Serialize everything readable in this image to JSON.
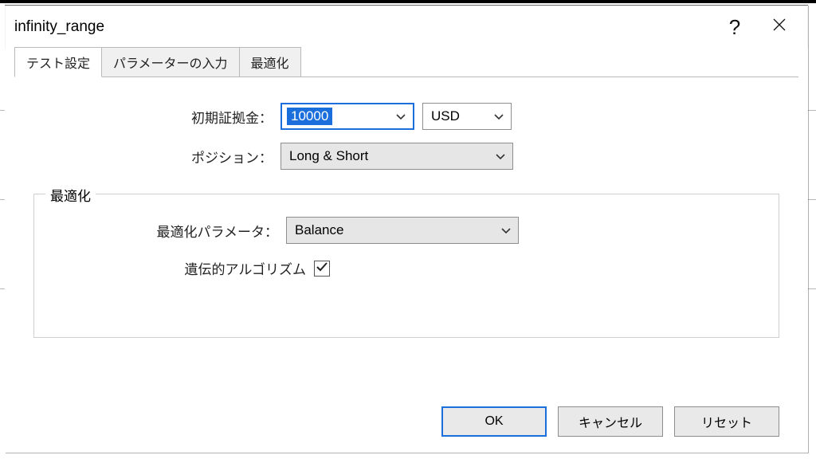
{
  "window": {
    "title": "infinity_range"
  },
  "tabs": [
    {
      "label": "テスト設定",
      "active": true
    },
    {
      "label": "パラメーターの入力",
      "active": false
    },
    {
      "label": "最適化",
      "active": false
    }
  ],
  "form": {
    "deposit_label": "初期証拠金：",
    "deposit_value": "10000",
    "currency_value": "USD",
    "position_label": "ポジション：",
    "position_value": "Long & Short"
  },
  "group": {
    "legend": "最適化",
    "param_label": "最適化パラメータ：",
    "param_value": "Balance",
    "ga_label": "遺伝的アルゴリズム",
    "ga_checked": true
  },
  "buttons": {
    "ok": "OK",
    "cancel": "キャンセル",
    "reset": "リセット"
  }
}
